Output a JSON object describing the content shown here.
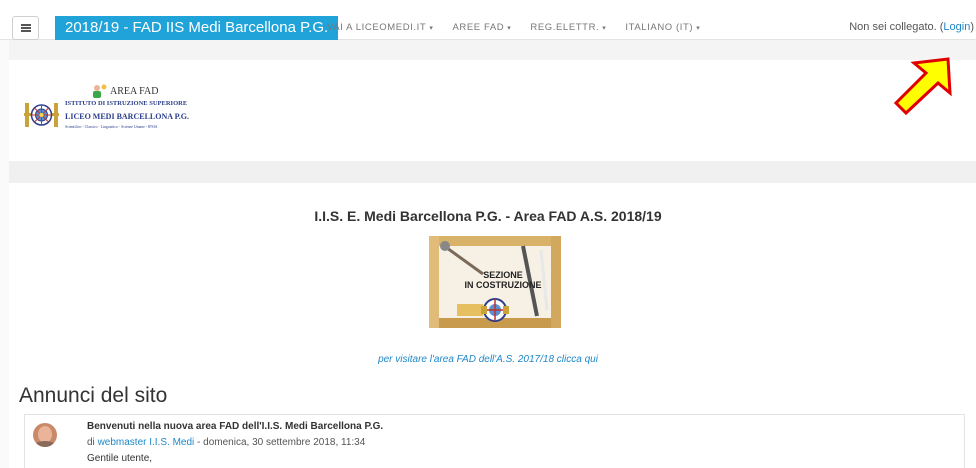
{
  "navbar": {
    "brand": "2018/19 - FAD IIS Medi Barcellona P.G.",
    "links": [
      {
        "label": "VAI A LICEOMEDI.IT"
      },
      {
        "label": "AREE FAD"
      },
      {
        "label": "REG.ELETTR."
      },
      {
        "label": "ITALIANO (IT)"
      }
    ],
    "caret": "▾",
    "login_status": "Non sei collegato. (",
    "login_link": "Login",
    "login_close": ")"
  },
  "logo": {
    "area_label": "AREA FAD",
    "line1": "ISTITUTO DI ISTRUZIONE SUPERIORE",
    "line2": "LICEO MEDI BARCELLONA P.G.",
    "line3": "Scientifico - Classico - Linguistico - Scienze Umane - IPSIA"
  },
  "main": {
    "heading": "I.I.S. E. Medi Barcellona P.G. - Area FAD A.S. 2018/19",
    "construction_line1": "SEZIONE",
    "construction_line2": "IN COSTRUZIONE",
    "old_area_link": "per visitare l'area FAD dell'A.S. 2017/18 clicca qui"
  },
  "news": {
    "section_title": "Annunci del sito",
    "post": {
      "title": "Benvenuti nella nuova area FAD dell'I.I.S. Medi Barcellona P.G.",
      "by": "di ",
      "author": "webmaster I.I.S. Medi",
      "date": " - domenica, 30 settembre 2018, 11:34",
      "body": "Gentile utente,"
    }
  },
  "colors": {
    "brand_bg": "#1fa3d8",
    "link": "#1e88c8",
    "arrow_fill": "#ffff00",
    "arrow_stroke": "#e00000"
  }
}
